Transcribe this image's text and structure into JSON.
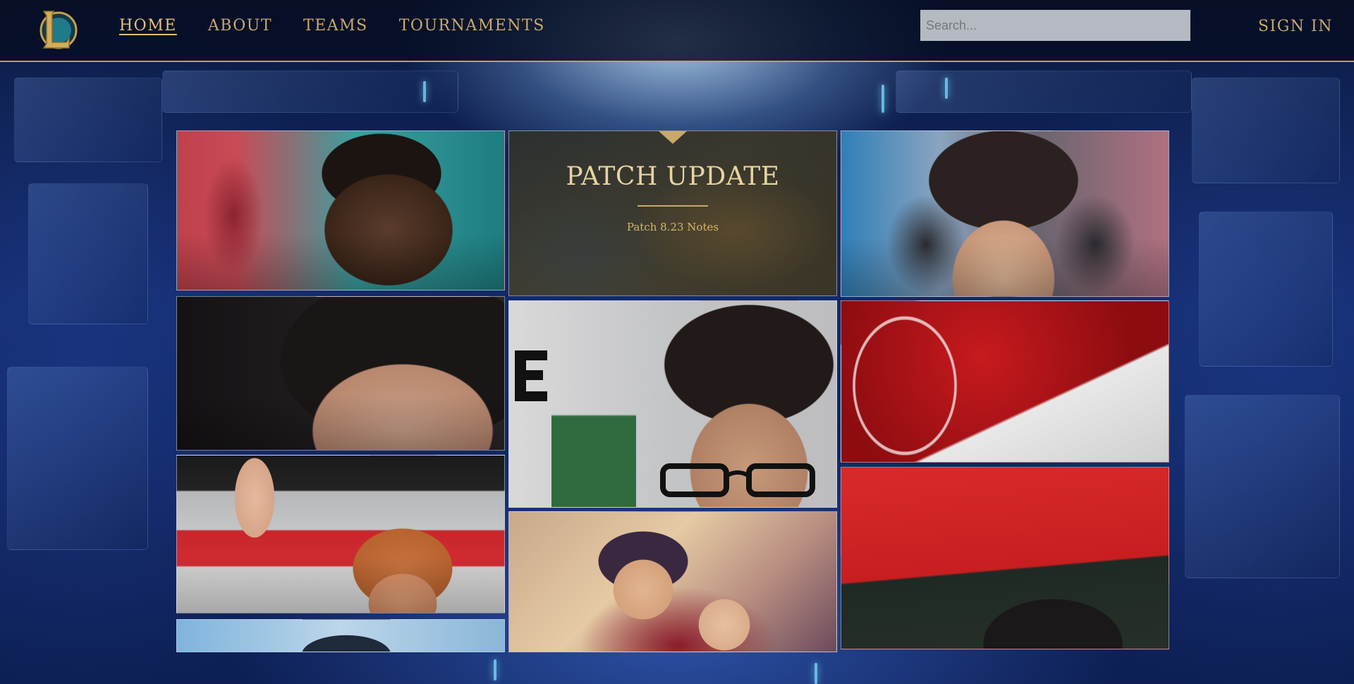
{
  "navbar": {
    "links": [
      {
        "label": "HOME",
        "active": true
      },
      {
        "label": "ABOUT",
        "active": false
      },
      {
        "label": "TEAMS",
        "active": false
      },
      {
        "label": "TOURNAMENTS",
        "active": false
      }
    ],
    "search": {
      "placeholder": "Search..."
    },
    "sign_in": "SIGN IN"
  },
  "patch": {
    "title": "PATCH UPDATE",
    "subtitle": "Patch 8.23 Notes"
  },
  "colors": {
    "accent_gold": "#c8a96a",
    "nav_bg": "#060e22",
    "page_bg": "#132a6b"
  }
}
